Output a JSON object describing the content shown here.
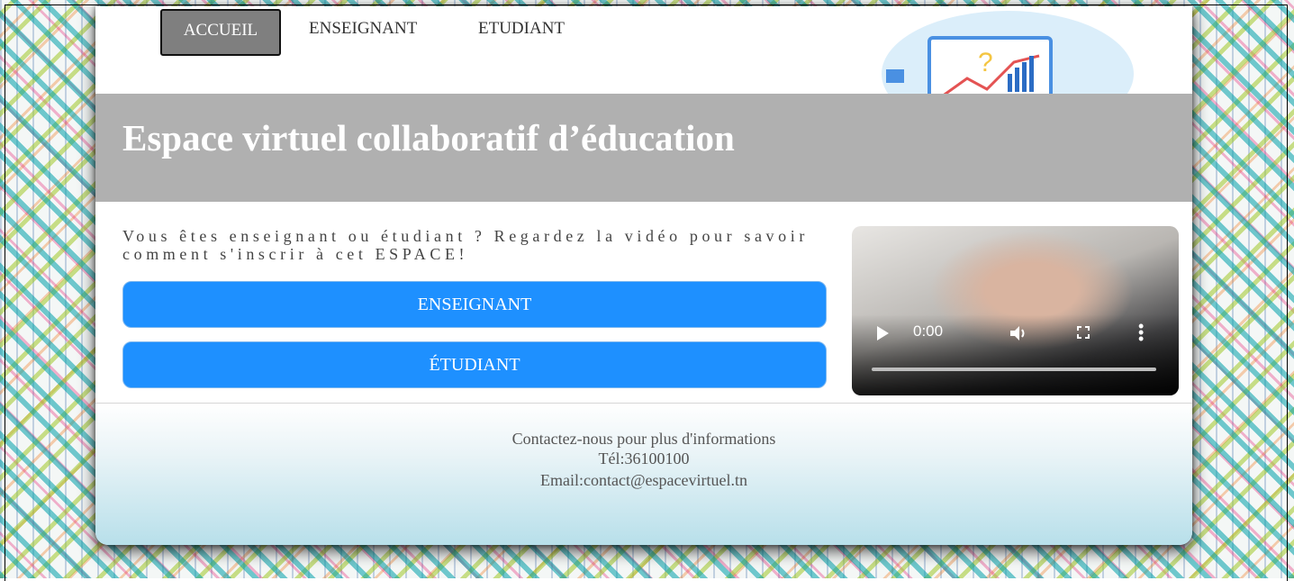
{
  "nav": {
    "items": [
      {
        "label": "ACCUEIL",
        "active": true
      },
      {
        "label": "ENSEIGNANT",
        "active": false
      },
      {
        "label": "ETUDIANT",
        "active": false
      }
    ]
  },
  "banner": {
    "title": "Espace virtuel collaboratif d’éducation",
    "background_color": "#b0b0b0",
    "illustration": "team-meeting-illustration"
  },
  "intro": {
    "text": "Vous êtes enseignant ou étudiant ? Regardez la vidéo pour savoir comment s'inscrir à cet ESPACE!"
  },
  "actions": {
    "teacher_label": "ENSEIGNANT",
    "student_label": "ÉTUDIANT",
    "button_color": "#1e90ff"
  },
  "video": {
    "time": "0:00",
    "progress": 0,
    "icons": [
      "play-icon",
      "volume-icon",
      "fullscreen-icon",
      "more-options-icon"
    ]
  },
  "footer": {
    "line1": "Contactez-nous pour plus d'informations",
    "phone": "Tél:36100100",
    "email": "Email:contact@espacevirtuel.tn"
  }
}
